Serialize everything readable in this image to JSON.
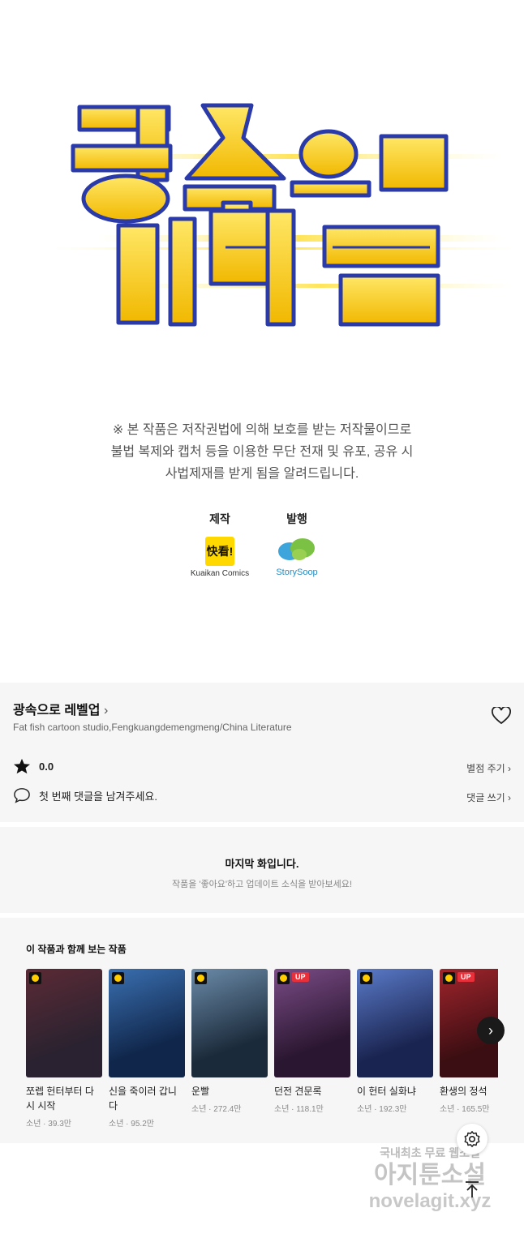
{
  "notice": {
    "line1": "※ 본 작품은 저작권법에 의해 보호를 받는 저작물이므로",
    "line2": "불법 복제와 캡처 등을  이용한 무단 전재 및 유포, 공유 시",
    "line3": "사법제재를  받게 됨을 알려드립니다."
  },
  "credits": {
    "production_label": "제작",
    "production_name": "Kuaikan Comics",
    "production_logo": "快看!",
    "publishing_label": "발행",
    "publishing_name": "StorySoop"
  },
  "work": {
    "title": "광속으로 레벨업",
    "authors": "Fat fish cartoon studio,Fengkuangdemengmeng/China Literature",
    "rating": "0.0",
    "rate_action": "별점 주기",
    "comment_prompt": "첫 번째 댓글을 남겨주세요.",
    "comment_action": "댓글 쓰기"
  },
  "last_episode": {
    "heading": "마지막 화입니다.",
    "sub": "작품을 '좋아요'하고 업데이트 소식을 받아보세요!"
  },
  "recommend": {
    "heading": "이 작품과 함께 보는 작품",
    "items": [
      {
        "title": "쪼렙 헌터부터 다시 시작",
        "meta": "소년 · 39.3만",
        "up": "",
        "color1": "#2a2230",
        "color2": "#5a2a35"
      },
      {
        "title": "신을 죽이러 갑니다",
        "meta": "소년 · 95.2만",
        "up": "",
        "color1": "#10264a",
        "color2": "#3a6fb0"
      },
      {
        "title": "운빨",
        "meta": "소년 · 272.4만",
        "up": "",
        "color1": "#1b2a3a",
        "color2": "#6a8aa8"
      },
      {
        "title": "던전 견문록",
        "meta": "소년 · 118.1만",
        "up": "UP",
        "color1": "#2a1630",
        "color2": "#7a4c86"
      },
      {
        "title": "이 헌터 실화냐",
        "meta": "소년 · 192.3만",
        "up": "",
        "color1": "#1a2450",
        "color2": "#5a7ac8"
      },
      {
        "title": "환생의 정석",
        "meta": "소년 · 165.5만",
        "up": "UP",
        "color1": "#3a0e12",
        "color2": "#a0242c"
      }
    ]
  },
  "watermark": {
    "line1": "국내최초 무료 웹소설",
    "line2": "아지툰소설",
    "line3": "novelagit.xyz"
  },
  "colors": {
    "accent_yellow": "#ffcc00",
    "up_badge": "#e8303b",
    "panel": "#f6f6f6"
  }
}
